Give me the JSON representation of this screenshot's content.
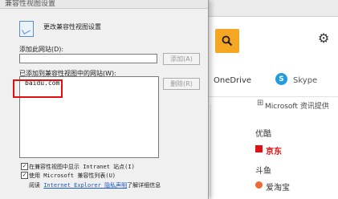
{
  "dialog": {
    "title": "兼容性视图设置",
    "heading": "更改兼容性视图设置",
    "add_site_label": "添加此网站(D):",
    "add_site_value": "",
    "add_button": "添加(A)",
    "list_label": "已添加到兼容性视图中的网站(W):",
    "sites": [
      "baidu.com"
    ],
    "remove_button": "删除(R)",
    "checkboxes": [
      {
        "label": "在兼容性视图中显示 Intranet 站点(I)",
        "checked": true
      },
      {
        "label": "使用 Microsoft 兼容性列表(U)",
        "checked": true
      }
    ],
    "footer_prefix": "阅读",
    "footer_link": "Internet Explorer 隐私声明",
    "footer_suffix": "了解详细信息"
  },
  "background": {
    "onedrive": "OneDrive",
    "skype_icon": "S",
    "skype": "Skype",
    "info_provider": "Microsoft 资讯提供",
    "items": [
      "优酷",
      "京东",
      "斗鱼",
      "爱淘宝"
    ],
    "accent_color": "#f5a623"
  },
  "icons": {
    "search": "search-icon",
    "gear": "gear-icon"
  }
}
